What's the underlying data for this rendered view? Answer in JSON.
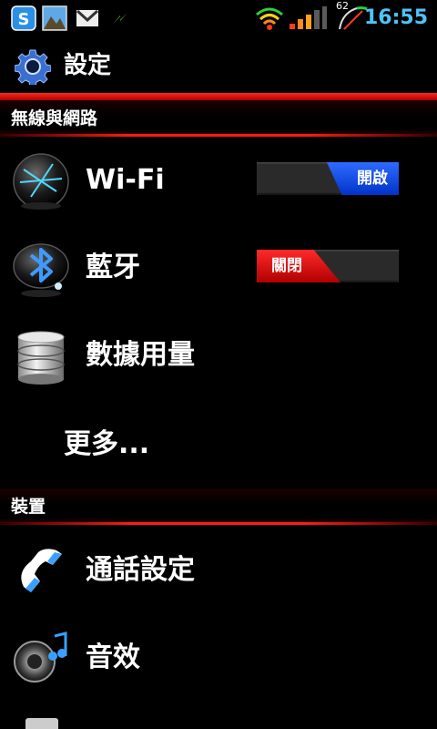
{
  "status_bar": {
    "icons": [
      "skype-icon",
      "photo-icon",
      "gmail-icon",
      "sync-icon",
      "wifi-icon",
      "signal-icon",
      "battery-gauge-icon"
    ],
    "battery_level": "62",
    "time": "16:55"
  },
  "header": {
    "title": "設定"
  },
  "sections": [
    {
      "title": "無線與網路",
      "items": [
        {
          "label": "Wi-Fi",
          "icon": "wifi-globe-icon",
          "toggle": {
            "state": "on",
            "label": "開啟"
          }
        },
        {
          "label": "藍牙",
          "icon": "bluetooth-icon",
          "toggle": {
            "state": "off",
            "label": "關閉"
          }
        },
        {
          "label": "數據用量",
          "icon": "database-icon"
        },
        {
          "label": "更多..."
        }
      ]
    },
    {
      "title": "裝置",
      "items": [
        {
          "label": "通話設定",
          "icon": "phone-icon"
        },
        {
          "label": "音效",
          "icon": "speaker-icon"
        }
      ]
    }
  ],
  "colors": {
    "accent_red": "#ff1a1a",
    "toggle_on": "#1e4fff",
    "toggle_off": "#e00000",
    "time_color": "#4fc3f7"
  }
}
